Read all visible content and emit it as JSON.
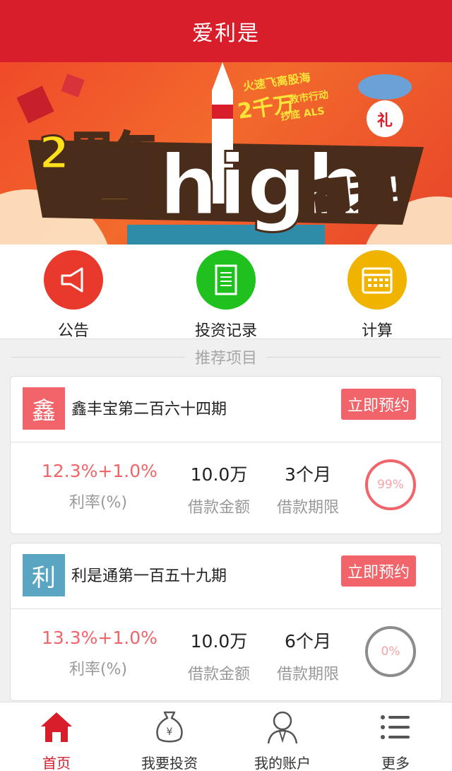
{
  "header": {
    "title": "爱利是"
  },
  "banner": {
    "line_top_1": "火速飞离股海",
    "line_top_2": "2千万",
    "line_top_3": "救市行动",
    "line_top_4": "抄底 ALS",
    "headline_1": "2周年",
    "headline_2": "一起",
    "headline_3": "high",
    "headline_4": "翻天!",
    "gift": "礼",
    "slide_count": 3,
    "active_slide": 1
  },
  "quick_menu": [
    {
      "label": "公告",
      "color": "#e8392c",
      "icon": "megaphone-icon"
    },
    {
      "label": "投资记录",
      "color": "#1fc11f",
      "icon": "document-icon"
    },
    {
      "label": "计算",
      "color": "#f0b400",
      "icon": "calendar-icon"
    }
  ],
  "section": {
    "title": "推荐项目"
  },
  "projects": [
    {
      "badge": "鑫",
      "badge_color": "#f0646a",
      "name": "鑫丰宝第二百六十四期",
      "button": "立即预约",
      "rate": "12.3%+1.0%",
      "rate_label": "利率(%)",
      "amount": "10.0万",
      "amount_label": "借款金额",
      "term": "3个月",
      "term_label": "借款期限",
      "progress": "99%",
      "ring_color": "#f0646a"
    },
    {
      "badge": "利",
      "badge_color": "#5aa5c2",
      "name": "利是通第一百五十九期",
      "button": "立即预约",
      "rate": "13.3%+1.0%",
      "rate_label": "利率(%)",
      "amount": "10.0万",
      "amount_label": "借款金额",
      "term": "6个月",
      "term_label": "借款期限",
      "progress": "0%",
      "ring_color": "#8c8c8c"
    }
  ],
  "tabbar": [
    {
      "label": "首页",
      "icon": "home-icon",
      "active": true
    },
    {
      "label": "我要投资",
      "icon": "money-bag-icon",
      "active": false
    },
    {
      "label": "我的账户",
      "icon": "user-icon",
      "active": false
    },
    {
      "label": "更多",
      "icon": "list-icon",
      "active": false
    }
  ],
  "colors": {
    "brand_red": "#d81e2a",
    "accent": "#f0646a"
  }
}
